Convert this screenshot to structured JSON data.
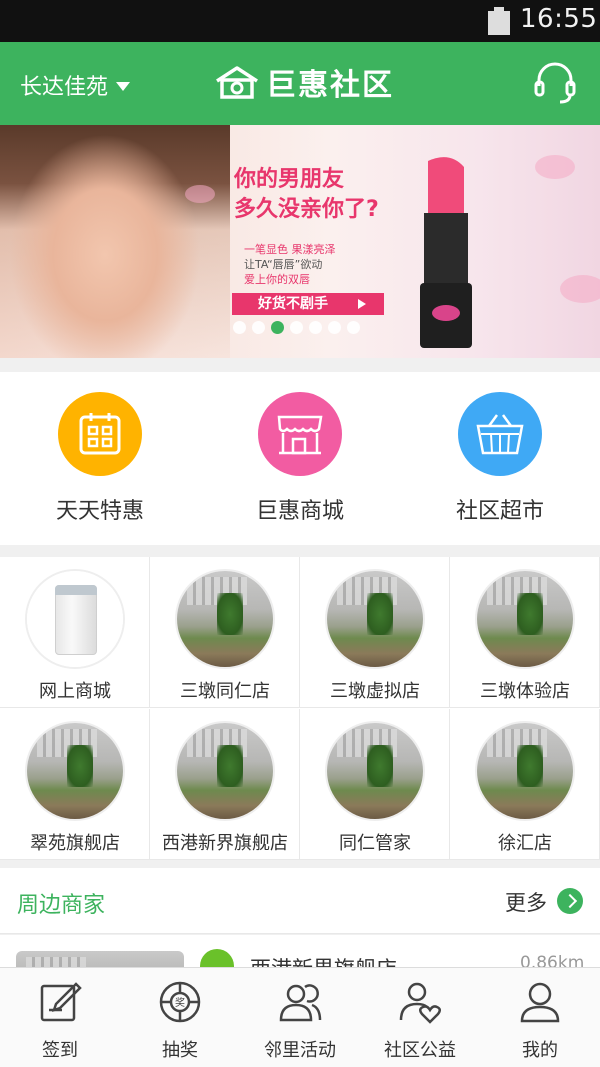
{
  "status_bar": {
    "time": "16:55"
  },
  "header": {
    "location": "长达佳苑",
    "brand": "巨惠社区"
  },
  "banner": {
    "headline_line1": "你的男朋友",
    "headline_line2": "多久没亲你了?",
    "subline1": "一笔显色 果漾亮泽",
    "subline2": "让TA“唇唇”欲动",
    "subline3": "爱上你的双唇",
    "cta": "好货不剧手",
    "slide_count": 7,
    "active_slide": 3
  },
  "categories": [
    {
      "label": "天天特惠",
      "icon": "calendar-icon",
      "color": "#ffb300"
    },
    {
      "label": "巨惠商城",
      "icon": "storefront-icon",
      "color": "#f25ca2"
    },
    {
      "label": "社区超市",
      "icon": "basket-icon",
      "color": "#3fa9f5"
    }
  ],
  "stores": [
    {
      "label": "网上商城",
      "thumb": "washer"
    },
    {
      "label": "三墩同仁店",
      "thumb": "building"
    },
    {
      "label": "三墩虚拟店",
      "thumb": "building"
    },
    {
      "label": "三墩体验店",
      "thumb": "building"
    },
    {
      "label": "翠苑旗舰店",
      "thumb": "building"
    },
    {
      "label": "西港新界旗舰店",
      "thumb": "building"
    },
    {
      "label": "同仁管家",
      "thumb": "building"
    },
    {
      "label": "徐汇店",
      "thumb": "building"
    }
  ],
  "nearby": {
    "title": "周边商家",
    "more": "更多",
    "first_item": {
      "name": "西港新界旗舰店",
      "distance": "0.86km"
    }
  },
  "tabbar": [
    {
      "label": "签到",
      "icon": "checkin-icon"
    },
    {
      "label": "抽奖",
      "icon": "lottery-icon"
    },
    {
      "label": "邻里活动",
      "icon": "neighbors-icon"
    },
    {
      "label": "社区公益",
      "icon": "charity-icon"
    },
    {
      "label": "我的",
      "icon": "profile-icon"
    }
  ],
  "colors": {
    "primary": "#3db35e",
    "accent_pink": "#e8366c"
  }
}
